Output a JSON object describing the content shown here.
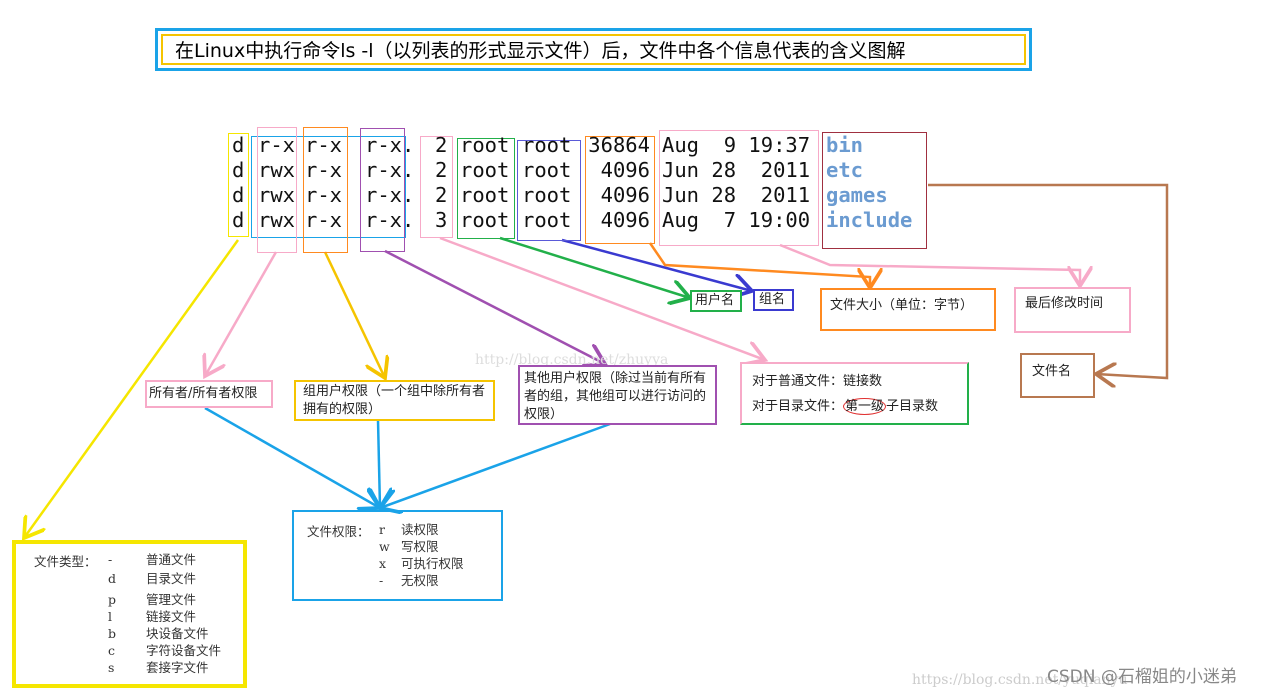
{
  "title": "在Linux中执行命令ls -l（以列表的形式显示文件）后，文件中各个信息代表的含义图解",
  "listing": [
    {
      "type": "d",
      "owner_perm": "r-x",
      "group_perm": "r-x",
      "other_perm": "r-x.",
      "links": "2",
      "user": "root",
      "group": "root",
      "size": "36864",
      "date": "Aug  9 19:37",
      "name": "bin"
    },
    {
      "type": "d",
      "owner_perm": "rwx",
      "group_perm": "r-x",
      "other_perm": "r-x.",
      "links": "2",
      "user": "root",
      "group": "root",
      "size": "4096",
      "date": "Jun 28  2011",
      "name": "etc"
    },
    {
      "type": "d",
      "owner_perm": "rwx",
      "group_perm": "r-x",
      "other_perm": "r-x.",
      "links": "2",
      "user": "root",
      "group": "root",
      "size": "4096",
      "date": "Jun 28  2011",
      "name": "games"
    },
    {
      "type": "d",
      "owner_perm": "rwx",
      "group_perm": "r-x",
      "other_perm": "r-x.",
      "links": "3",
      "user": "root",
      "group": "root",
      "size": "4096",
      "date": "Aug  7 19:00",
      "name": "include"
    }
  ],
  "labels": {
    "user": "用户名",
    "group": "组名",
    "size": "文件大小（单位：字节）",
    "mtime": "最后修改时间",
    "filename": "文件名",
    "links_regular": "对于普通文件：链接数",
    "links_dir_prefix": "对于目录文件：",
    "links_dir_circled": "第一级",
    "links_dir_suffix": "子目录数",
    "other": "其他用户权限（除过当前有所有者的组，其他组可以进行访问的权限）",
    "group_perm": "组用户权限（一个组中除所有者拥有的权限）",
    "owner": "所有者/所有者权限"
  },
  "file_types": {
    "heading": "文件类型：",
    "items": [
      {
        "code": "-",
        "desc": "普通文件"
      },
      {
        "code": "d",
        "desc": "目录文件"
      },
      {
        "code": "p",
        "desc": "管理文件"
      },
      {
        "code": "l",
        "desc": "链接文件"
      },
      {
        "code": "b",
        "desc": "块设备文件"
      },
      {
        "code": "c",
        "desc": "字符设备文件"
      },
      {
        "code": "s",
        "desc": "套接字文件"
      }
    ]
  },
  "permissions": {
    "heading": "文件权限：",
    "items": [
      {
        "code": "r",
        "desc": "读权限"
      },
      {
        "code": "w",
        "desc": "写权限"
      },
      {
        "code": "x",
        "desc": "可执行权限"
      },
      {
        "code": "-",
        "desc": "无权限"
      }
    ]
  },
  "watermark": {
    "faint_url": "http://blog.csdn.net/zhuyya",
    "bottom_url": "https://blog.csdn.net/yuqianyu",
    "credit": "CSDN @石榴姐的小迷弟"
  },
  "colors": {
    "yellow": "#f5e600",
    "pink": "#f7aac8",
    "blue": "#1aa3e8",
    "orange": "#ff8a20",
    "purple": "#a050b0",
    "green": "#22b04a",
    "darkblue": "#3a3ad0",
    "brown": "#b87850",
    "darkred": "#a03040"
  }
}
